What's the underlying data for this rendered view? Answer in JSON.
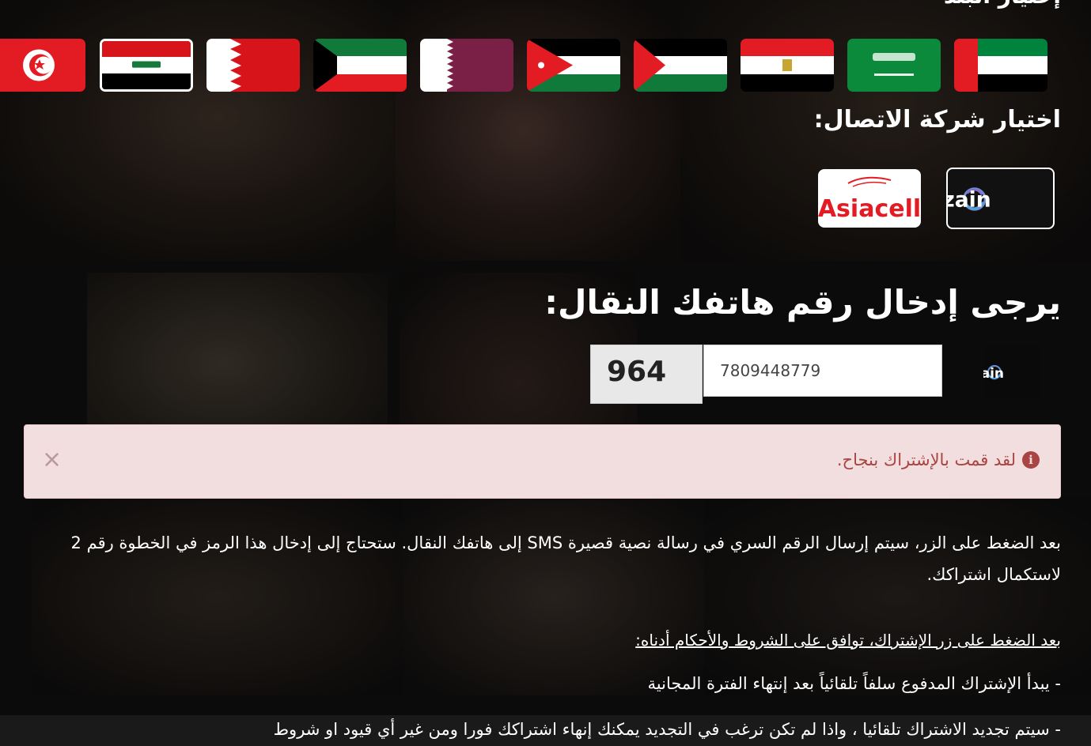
{
  "country_heading": "إختيار البلد",
  "flags": [
    {
      "name": "UAE"
    },
    {
      "name": "Saudi Arabia"
    },
    {
      "name": "Egypt"
    },
    {
      "name": "Palestine"
    },
    {
      "name": "Jordan"
    },
    {
      "name": "Qatar"
    },
    {
      "name": "Kuwait"
    },
    {
      "name": "Bahrain"
    },
    {
      "name": "Iraq",
      "selected": true
    },
    {
      "name": "Tunisia"
    }
  ],
  "carrier_heading": "اختيار شركة الاتصال:",
  "carriers": [
    {
      "name": "zain",
      "selected": true
    },
    {
      "name": "Asiacell"
    }
  ],
  "phone": {
    "heading": "يرجى إدخال رقم هاتفك النقال:",
    "prefix": "964",
    "value": "7809448779"
  },
  "alert": {
    "close": "×",
    "message": "لقد قمت بالإشتراك بنجاح."
  },
  "instructions": "بعد الضغط على الزر، سيتم إرسال الرقم السري في رسالة نصية قصيرة SMS إلى هاتفك النقال. ستحتاج إلى إدخال هذا الرمز في الخطوة رقم 2 لاستكمال اشتراكك.",
  "terms_link": "بعد الضغط على زر الإشتراك، توافق على الشروط والأحكام أدناه:",
  "terms": [
    "- يبدأ الإشتراك المدفوع سلفاً تلقائياً بعد إنتهاء الفترة المجانية",
    "- سيتم تجديد الاشتراك تلقائيا ، واذا لم تكن ترغب في التجديد يمكنك إنهاء اشتراكك فورا ومن غير أي قيود او شروط"
  ],
  "colors": {
    "alert_bg": "#f2dede",
    "alert_text": "#a94442",
    "page_bg": "#131313"
  }
}
